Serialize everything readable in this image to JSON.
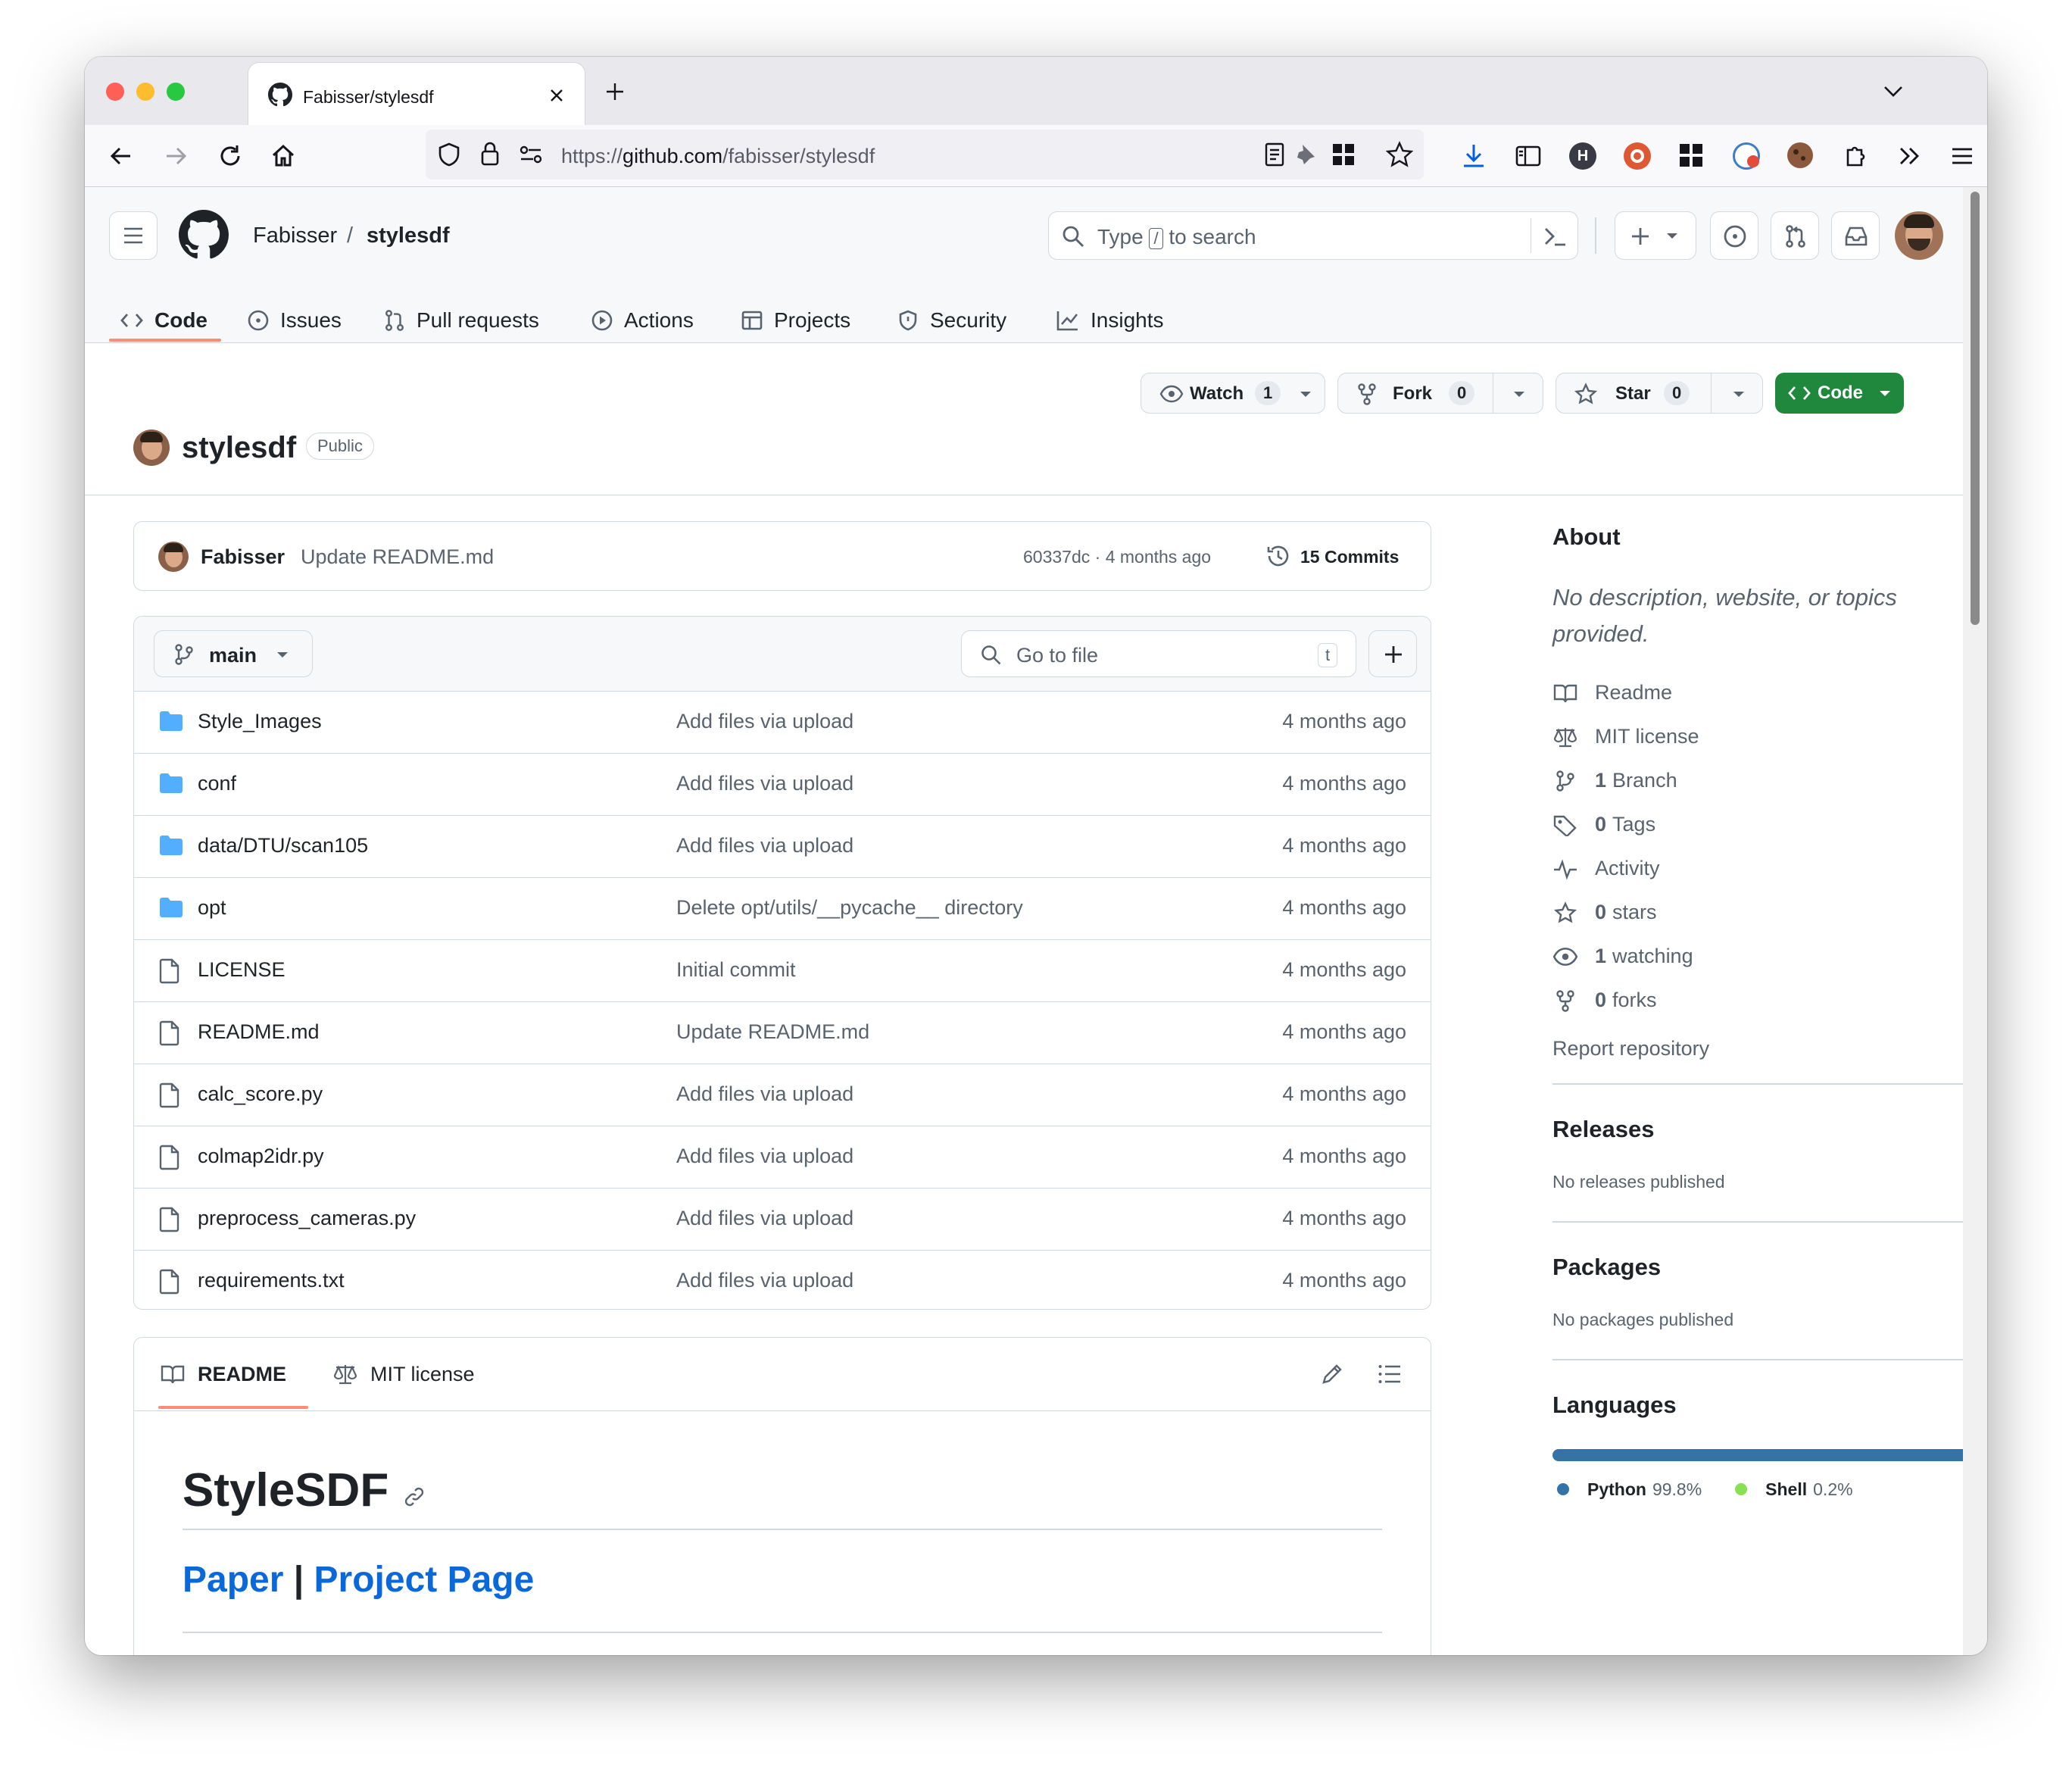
{
  "browser": {
    "tab_title": "Fabisser/stylesdf",
    "url_prefix": "https://",
    "url_host": "github.com",
    "url_path": "/fabisser/stylesdf"
  },
  "header": {
    "owner": "Fabisser",
    "separator": "/",
    "repo": "stylesdf",
    "search_pre": "Type",
    "search_key": "/",
    "search_post": "to search"
  },
  "repo_nav": {
    "code": "Code",
    "issues": "Issues",
    "pulls": "Pull requests",
    "actions": "Actions",
    "projects": "Projects",
    "security": "Security",
    "insights": "Insights"
  },
  "repo_head": {
    "name": "stylesdf",
    "visibility": "Public",
    "watch_label": "Watch",
    "watch_count": "1",
    "fork_label": "Fork",
    "fork_count": "0",
    "star_label": "Star",
    "star_count": "0",
    "code_label": "Code"
  },
  "last_commit": {
    "author": "Fabisser",
    "message": "Update README.md",
    "meta": "60337dc · 4 months ago",
    "commits": "15 Commits"
  },
  "file_toolbar": {
    "branch": "main",
    "goto_placeholder": "Go to file",
    "goto_key": "t"
  },
  "files": [
    {
      "name": "Style_Images",
      "type": "dir",
      "message": "Add files via upload",
      "date": "4 months ago"
    },
    {
      "name": "conf",
      "type": "dir",
      "message": "Add files via upload",
      "date": "4 months ago"
    },
    {
      "name": "data/DTU/scan105",
      "type": "dir",
      "message": "Add files via upload",
      "date": "4 months ago"
    },
    {
      "name": "opt",
      "type": "dir",
      "message": "Delete opt/utils/__pycache__ directory",
      "date": "4 months ago"
    },
    {
      "name": "LICENSE",
      "type": "file",
      "message": "Initial commit",
      "date": "4 months ago"
    },
    {
      "name": "README.md",
      "type": "file",
      "message": "Update README.md",
      "date": "4 months ago"
    },
    {
      "name": "calc_score.py",
      "type": "file",
      "message": "Add files via upload",
      "date": "4 months ago"
    },
    {
      "name": "colmap2idr.py",
      "type": "file",
      "message": "Add files via upload",
      "date": "4 months ago"
    },
    {
      "name": "preprocess_cameras.py",
      "type": "file",
      "message": "Add files via upload",
      "date": "4 months ago"
    },
    {
      "name": "requirements.txt",
      "type": "file",
      "message": "Add files via upload",
      "date": "4 months ago"
    }
  ],
  "readme": {
    "tab_readme": "README",
    "tab_license": "MIT license",
    "title": "StyleSDF",
    "link_paper": "Paper",
    "link_sep": "|",
    "link_project": "Project Page"
  },
  "about": {
    "title": "About",
    "description": "No description, website, or topics provided.",
    "readme": "Readme",
    "license": "MIT license",
    "branch_count": "1",
    "branch_label": "Branch",
    "tags_count": "0",
    "tags_label": "Tags",
    "activity": "Activity",
    "stars_count": "0",
    "stars_label": "stars",
    "watching_count": "1",
    "watching_label": "watching",
    "forks_count": "0",
    "forks_label": "forks",
    "report": "Report repository"
  },
  "releases": {
    "title": "Releases",
    "text": "No releases published"
  },
  "packages": {
    "title": "Packages",
    "text": "No packages published"
  },
  "languages": {
    "title": "Languages",
    "items": [
      {
        "name": "Python",
        "percent": "99.8%",
        "share": 0.998,
        "color": "#3572A5"
      },
      {
        "name": "Shell",
        "percent": "0.2%",
        "share": 0.002,
        "color": "#89e051"
      }
    ]
  }
}
